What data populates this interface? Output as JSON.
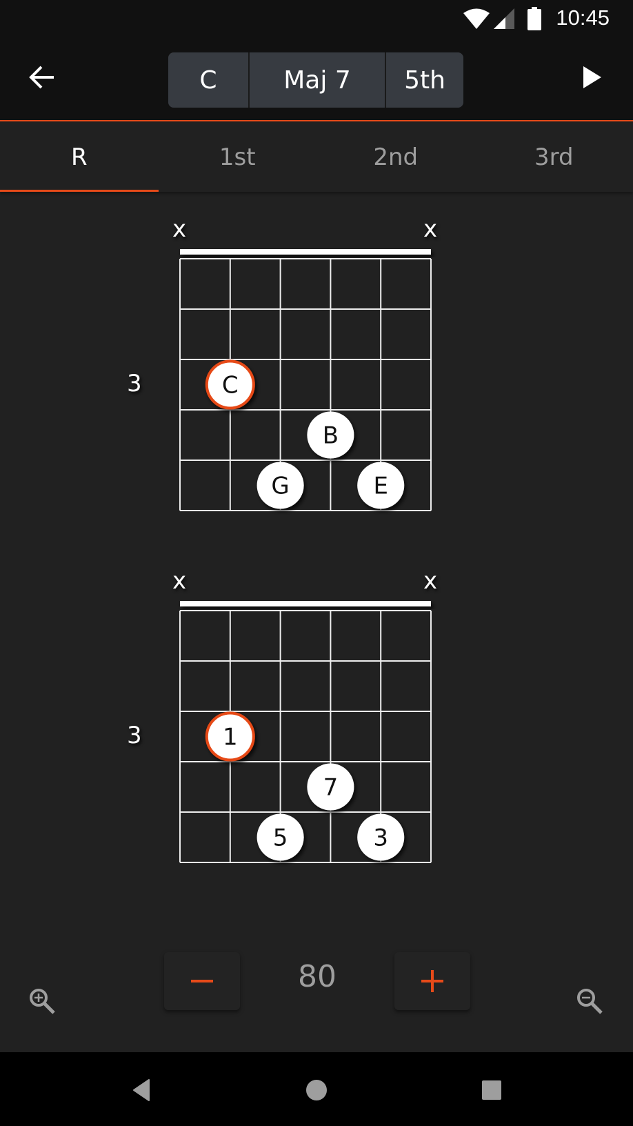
{
  "status_bar": {
    "time": "10:45",
    "icons": [
      "wifi-icon",
      "cell-signal-icon",
      "battery-icon"
    ]
  },
  "app_bar": {
    "back_icon": "arrow-left-icon",
    "play_icon": "play-icon",
    "chord_selector": [
      {
        "label": "C",
        "role": "root"
      },
      {
        "label": "Maj 7",
        "role": "quality"
      },
      {
        "label": "5th",
        "role": "position"
      }
    ]
  },
  "tabs": [
    {
      "label": "R",
      "active": true
    },
    {
      "label": "1st",
      "active": false
    },
    {
      "label": "2nd",
      "active": false
    },
    {
      "label": "3rd",
      "active": false
    }
  ],
  "colors": {
    "accent": "#e64a19",
    "background": "#212121",
    "app_bar": "#111111",
    "segment": "#373b41",
    "muted_text": "#9e9e9e"
  },
  "diagrams": [
    {
      "name": "note-names",
      "fret_label": "3",
      "strings": 6,
      "frets": 5,
      "muted_strings": [
        {
          "string": 1,
          "label": "x"
        },
        {
          "string": 6,
          "label": "x"
        }
      ],
      "dots": [
        {
          "string": 2,
          "fret": 3,
          "label": "C",
          "root": true
        },
        {
          "string": 4,
          "fret": 4,
          "label": "B",
          "root": false
        },
        {
          "string": 3,
          "fret": 5,
          "label": "G",
          "root": false
        },
        {
          "string": 5,
          "fret": 5,
          "label": "E",
          "root": false
        }
      ]
    },
    {
      "name": "intervals",
      "fret_label": "3",
      "strings": 6,
      "frets": 5,
      "muted_strings": [
        {
          "string": 1,
          "label": "x"
        },
        {
          "string": 6,
          "label": "x"
        }
      ],
      "dots": [
        {
          "string": 2,
          "fret": 3,
          "label": "1",
          "root": true
        },
        {
          "string": 4,
          "fret": 4,
          "label": "7",
          "root": false
        },
        {
          "string": 3,
          "fret": 5,
          "label": "5",
          "root": false
        },
        {
          "string": 5,
          "fret": 5,
          "label": "3",
          "root": false
        }
      ]
    }
  ],
  "controls": {
    "tempo": "80",
    "decrease_icon": "minus-icon",
    "increase_icon": "plus-icon",
    "zoom_in_icon": "zoom-in-icon",
    "zoom_out_icon": "zoom-out-icon"
  },
  "nav_bar": {
    "back": "nav-back-icon",
    "home": "nav-home-icon",
    "recents": "nav-recents-icon"
  }
}
